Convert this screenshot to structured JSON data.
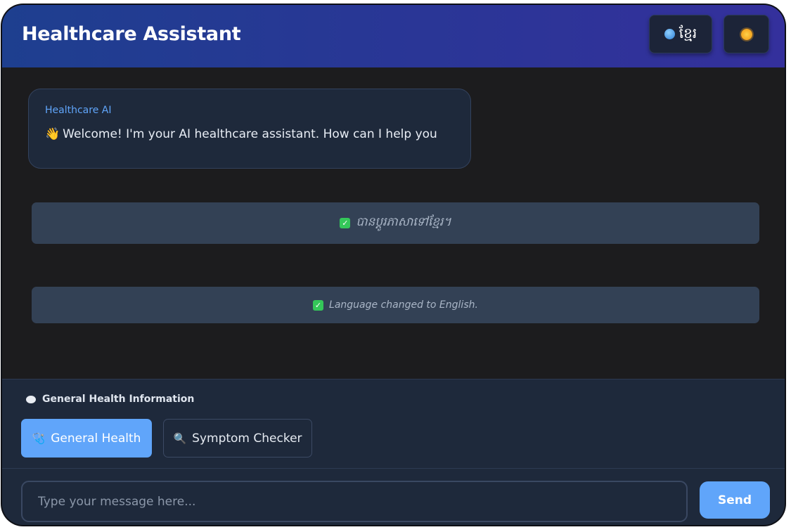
{
  "header": {
    "title": "Healthcare Assistant",
    "language_button_label": "ខ្មែរ",
    "language_icon": "globe-icon",
    "theme_icon": "sun-icon"
  },
  "chat": {
    "messages": [
      {
        "sender": "Healthcare AI",
        "icon": "waving-hand-icon",
        "text": "Welcome! I'm your AI healthcare assistant. How can I help you"
      }
    ],
    "notices": [
      {
        "icon": "check-icon",
        "text": "បានប្តូរភាសាទៅខ្មែរ។"
      },
      {
        "icon": "check-icon",
        "text": "Language changed to English."
      }
    ]
  },
  "quick_panel": {
    "label": "General Health Information",
    "label_icon": "speech-bubble-icon",
    "buttons": [
      {
        "label": "General Health",
        "icon": "stethoscope-icon",
        "active": true
      },
      {
        "label": "Symptom Checker",
        "icon": "magnifier-icon",
        "active": false
      }
    ]
  },
  "composer": {
    "placeholder": "Type your message here...",
    "value": "",
    "send_label": "Send"
  },
  "colors": {
    "header_gradient_start": "#1e3f8f",
    "header_gradient_end": "#34309c",
    "accent": "#60a5fa",
    "panel": "#1e293b",
    "background": "#1c1c1e",
    "notice": "#334155"
  }
}
